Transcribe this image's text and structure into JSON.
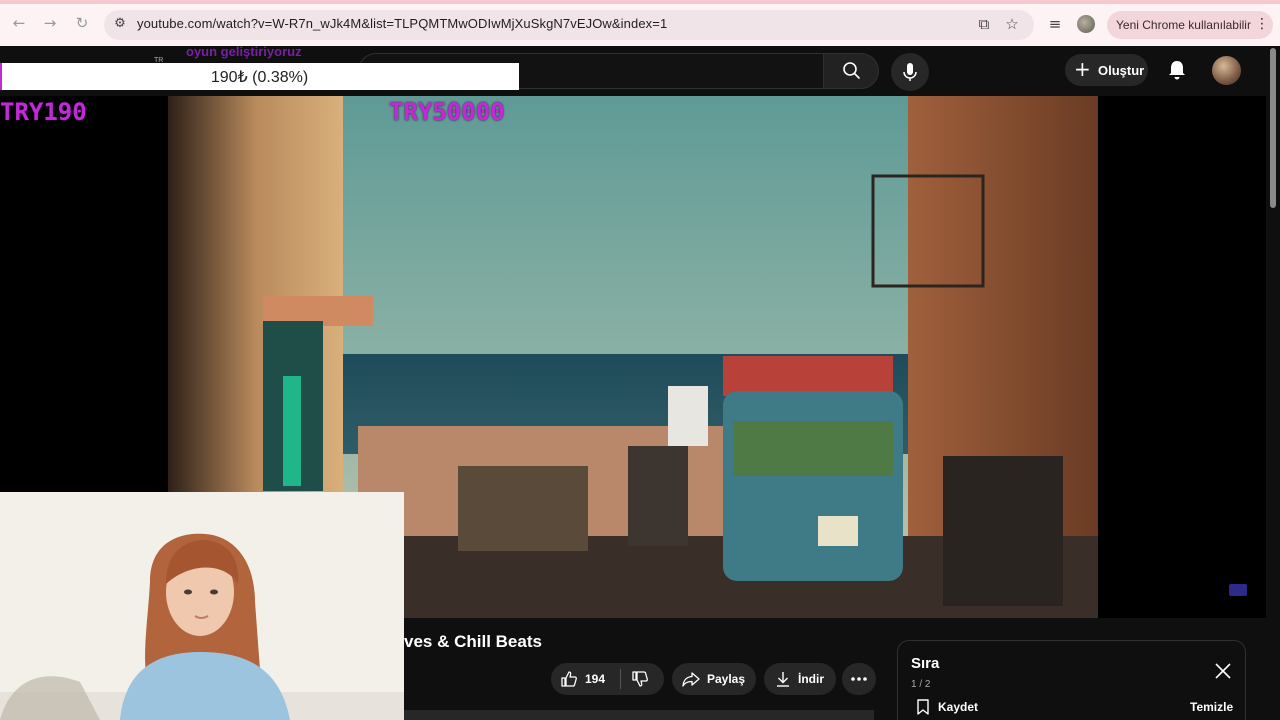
{
  "browser": {
    "url": "youtube.com/watch?v=W-R7n_wJk4M&list=TLPQMTMwODIwMjXuSkgN7vEJOw&index=1",
    "chrome_notice": "Yeni Chrome kullanılabilir",
    "nav_icons": [
      "back-icon",
      "forward-icon",
      "reload-icon"
    ],
    "colors": {
      "tab_strip": "#f6c9d1",
      "pill": "#f3d6dc"
    }
  },
  "header": {
    "create_label": "Oluştur",
    "icons": [
      "search-icon",
      "mic-icon",
      "bell-icon",
      "plus-icon"
    ]
  },
  "overlay": {
    "stream_note": "oyun geliştiriyoruz",
    "region_mark": "TR",
    "goal_text": "190₺ (0.38%)",
    "goal_progress": 0.0038,
    "donation_current": "TRY190",
    "donation_target": "TRY50000",
    "accent_color": "#c12bd6"
  },
  "video": {
    "title": "ves & Chill Beats",
    "likes": "194",
    "share_label": "Paylaş",
    "download_label": "İndir"
  },
  "queue": {
    "title": "Sıra",
    "position": "1 / 2",
    "save_label": "Kaydet",
    "clear_label": "Temizle"
  }
}
